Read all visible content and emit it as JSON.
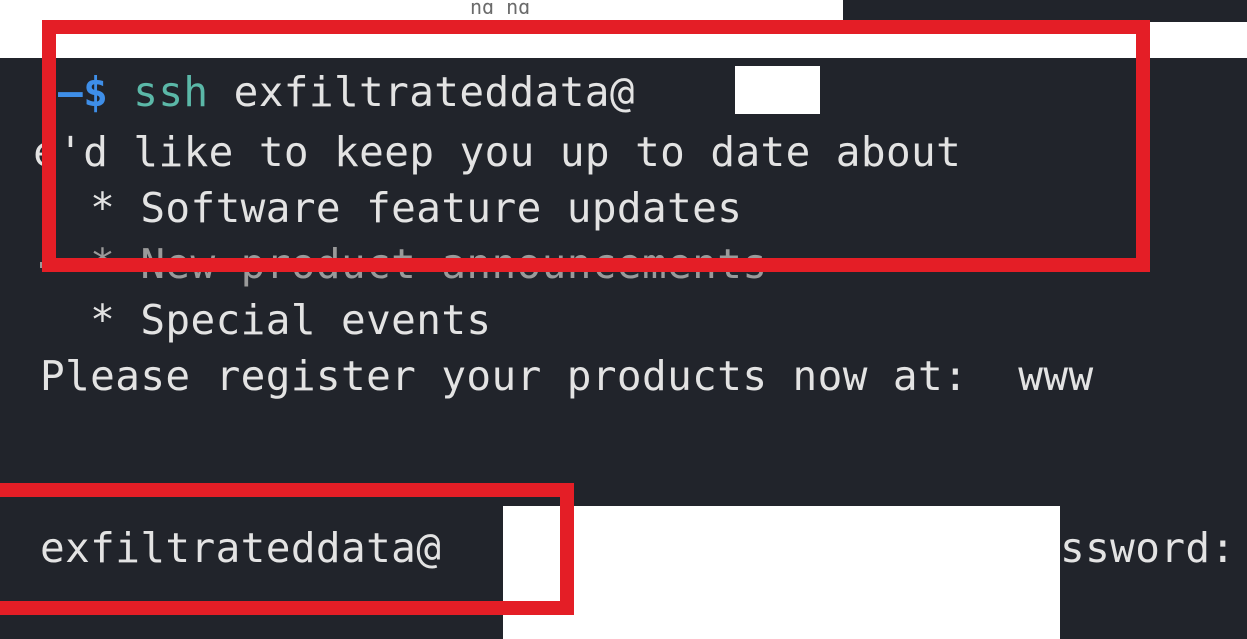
{
  "header_fragment": "ng ng",
  "terminal": {
    "prompt_symbol": "—$",
    "command": "ssh",
    "command_arg": "exfiltrateddata@",
    "banner_line": "We'd like to keep you up to date about",
    "bullet_1": "  * Software feature updates",
    "bullet_2": "  * New product announcements",
    "bullet_3": "  * Special events",
    "register_line": "Please register your products now at:  www",
    "password_prompt_user": "exfiltrateddata@",
    "password_prompt_tail": "ssword:"
  },
  "annotation_color": "#e41e26",
  "terminal_background": "#21242b"
}
